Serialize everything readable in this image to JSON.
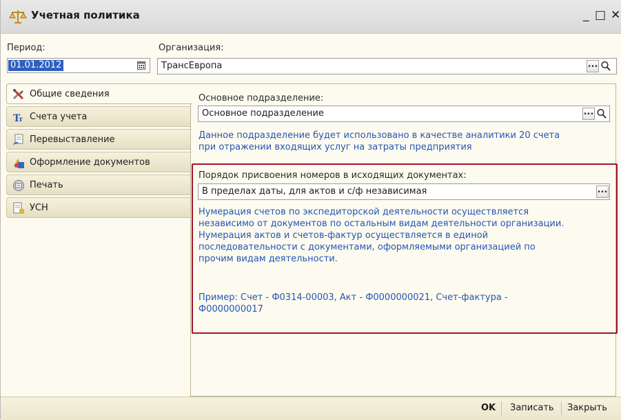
{
  "window": {
    "title": "Учетная политика",
    "minimize_glyph": "_",
    "maximize_glyph": "□",
    "close_glyph": "✕"
  },
  "header": {
    "period_label": "Период:",
    "period_value": "01.01.2012",
    "organization_label": "Организация:",
    "organization_value": "ТрансЕвропа"
  },
  "tabs": [
    {
      "label": "Общие сведения",
      "icon": "tools-icon",
      "active": true
    },
    {
      "label": "Счета учета",
      "icon": "accounts-icon",
      "active": false
    },
    {
      "label": "Перевыставление",
      "icon": "reissue-icon",
      "active": false
    },
    {
      "label": "Оформление документов",
      "icon": "documents-icon",
      "active": false
    },
    {
      "label": "Печать",
      "icon": "print-icon",
      "active": false
    },
    {
      "label": "УСН",
      "icon": "usn-icon",
      "active": false
    }
  ],
  "main": {
    "division_label": "Основное подразделение:",
    "division_value": "Основное подразделение",
    "division_note_line1": "Данное подразделение будет использовано в качестве аналитики 20 счета",
    "division_note_line2": "при отражении входящих услуг на затраты предприятия",
    "numbering_label": "Порядок присвоения номеров в исходящих документах:",
    "numbering_value": "В пределах даты, для актов и с/ф  независимая",
    "numbering_note": [
      "Нумерация счетов по экспедиторской деятельности осуществляется",
      "независимо от документов по остальным видам деятельности организации.",
      "Нумерация актов и счетов-фактур осуществляется в единой",
      "последовательности с документами, оформляемыми организацией по",
      "прочим видам деятельности."
    ],
    "example_line1": "Пример: Счет - Ф0314-00003, Акт - Ф0000000021, Счет-фактура -",
    "example_line2": "Ф0000000017"
  },
  "footer": {
    "ok_label": "OK",
    "save_label": "Записать",
    "close_label": "Закрыть"
  },
  "colors": {
    "note_text": "#2554b8",
    "highlight_border": "#a1152a",
    "selection": "#2f5fc0"
  }
}
